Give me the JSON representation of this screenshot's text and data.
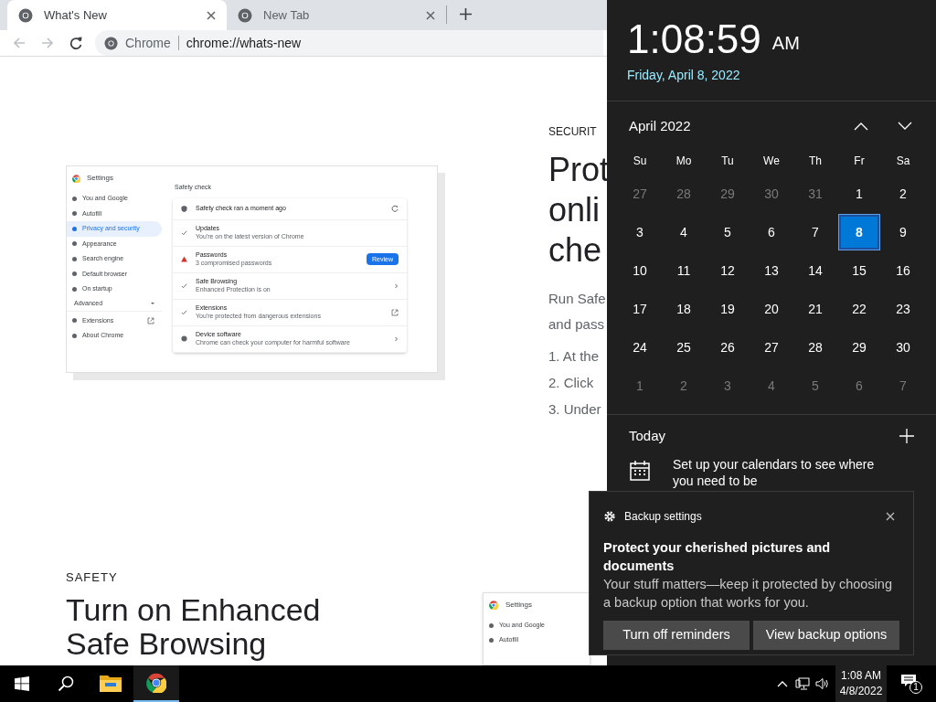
{
  "browser": {
    "tabs": [
      {
        "title": "What's New",
        "selected": true
      },
      {
        "title": "New Tab",
        "selected": false
      }
    ],
    "address": {
      "site": "Chrome",
      "url": "chrome://whats-new"
    }
  },
  "page": {
    "inset": {
      "title": "Settings",
      "nav": [
        {
          "label": "You and Google",
          "selected": false
        },
        {
          "label": "Autofill",
          "selected": false
        },
        {
          "label": "Privacy and security",
          "selected": true
        },
        {
          "label": "Appearance",
          "selected": false
        },
        {
          "label": "Search engine",
          "selected": false
        },
        {
          "label": "Default browser",
          "selected": false
        },
        {
          "label": "On startup",
          "selected": false
        }
      ],
      "advanced": "Advanced",
      "nav_bottom": [
        {
          "label": "Extensions",
          "kind": "external"
        },
        {
          "label": "About Chrome",
          "kind": "plain"
        }
      ],
      "section": "Safety check",
      "rows": [
        {
          "kind": "status",
          "title": "Safety check ran a moment ago",
          "trail": {
            "kind": "refresh"
          }
        },
        {
          "kind": "check",
          "title": "Updates",
          "subtitle": "You're on the latest version of Chrome"
        },
        {
          "kind": "warning",
          "title": "Passwords",
          "subtitle": "3 compromised passwords",
          "trail": {
            "kind": "button",
            "label": "Review"
          }
        },
        {
          "kind": "check",
          "title": "Safe Browsing",
          "subtitle": "Enhanced Protection is on",
          "trail": {
            "kind": "chevron"
          }
        },
        {
          "kind": "check",
          "title": "Extensions",
          "subtitle": "You're protected from dangerous extensions",
          "trail": {
            "kind": "external"
          }
        },
        {
          "kind": "info",
          "title": "Device software",
          "subtitle": "Chrome can check your computer for harmful software",
          "trail": {
            "kind": "chevron"
          }
        }
      ]
    },
    "security": {
      "eyebrow": "SECURIT",
      "heading": [
        "Prot",
        "onli",
        "che"
      ],
      "body": [
        "Run Safe",
        "and pass"
      ],
      "steps": [
        "1. At the",
        "2. Click",
        "3. Under"
      ]
    },
    "safety": {
      "eyebrow": "SAFETY",
      "heading": [
        "Turn on Enhanced",
        "Safe Browsing"
      ]
    },
    "inset2": {
      "title": "Settings",
      "nav": [
        "You and Google",
        "Autofill"
      ]
    }
  },
  "calendar": {
    "time": "1:08:59",
    "ampm": "AM",
    "date": "Friday, April 8, 2022",
    "month": "April 2022",
    "weekdays": [
      "Su",
      "Mo",
      "Tu",
      "We",
      "Th",
      "Fr",
      "Sa"
    ],
    "weeks": [
      [
        {
          "d": "27",
          "in_month": false,
          "selected": false
        },
        {
          "d": "28",
          "in_month": false,
          "selected": false
        },
        {
          "d": "29",
          "in_month": false,
          "selected": false
        },
        {
          "d": "30",
          "in_month": false,
          "selected": false
        },
        {
          "d": "31",
          "in_month": false,
          "selected": false
        },
        {
          "d": "1",
          "in_month": true,
          "selected": false
        },
        {
          "d": "2",
          "in_month": true,
          "selected": false
        }
      ],
      [
        {
          "d": "3",
          "in_month": true,
          "selected": false
        },
        {
          "d": "4",
          "in_month": true,
          "selected": false
        },
        {
          "d": "5",
          "in_month": true,
          "selected": false
        },
        {
          "d": "6",
          "in_month": true,
          "selected": false
        },
        {
          "d": "7",
          "in_month": true,
          "selected": false
        },
        {
          "d": "8",
          "in_month": true,
          "selected": true
        },
        {
          "d": "9",
          "in_month": true,
          "selected": false
        }
      ],
      [
        {
          "d": "10",
          "in_month": true,
          "selected": false
        },
        {
          "d": "11",
          "in_month": true,
          "selected": false
        },
        {
          "d": "12",
          "in_month": true,
          "selected": false
        },
        {
          "d": "13",
          "in_month": true,
          "selected": false
        },
        {
          "d": "14",
          "in_month": true,
          "selected": false
        },
        {
          "d": "15",
          "in_month": true,
          "selected": false
        },
        {
          "d": "16",
          "in_month": true,
          "selected": false
        }
      ],
      [
        {
          "d": "17",
          "in_month": true,
          "selected": false
        },
        {
          "d": "18",
          "in_month": true,
          "selected": false
        },
        {
          "d": "19",
          "in_month": true,
          "selected": false
        },
        {
          "d": "20",
          "in_month": true,
          "selected": false
        },
        {
          "d": "21",
          "in_month": true,
          "selected": false
        },
        {
          "d": "22",
          "in_month": true,
          "selected": false
        },
        {
          "d": "23",
          "in_month": true,
          "selected": false
        }
      ],
      [
        {
          "d": "24",
          "in_month": true,
          "selected": false
        },
        {
          "d": "25",
          "in_month": true,
          "selected": false
        },
        {
          "d": "26",
          "in_month": true,
          "selected": false
        },
        {
          "d": "27",
          "in_month": true,
          "selected": false
        },
        {
          "d": "28",
          "in_month": true,
          "selected": false
        },
        {
          "d": "29",
          "in_month": true,
          "selected": false
        },
        {
          "d": "30",
          "in_month": true,
          "selected": false
        }
      ],
      [
        {
          "d": "1",
          "in_month": false,
          "selected": false
        },
        {
          "d": "2",
          "in_month": false,
          "selected": false
        },
        {
          "d": "3",
          "in_month": false,
          "selected": false
        },
        {
          "d": "4",
          "in_month": false,
          "selected": false
        },
        {
          "d": "5",
          "in_month": false,
          "selected": false
        },
        {
          "d": "6",
          "in_month": false,
          "selected": false
        },
        {
          "d": "7",
          "in_month": false,
          "selected": false
        }
      ]
    ],
    "today": "Today",
    "agenda_hint": "Set up your calendars to see where you need to be"
  },
  "toast": {
    "app": "Backup settings",
    "title": "Protect your cherished pictures and documents",
    "body": "Your stuff matters—keep it protected by choosing a backup option that works for you.",
    "buttons": [
      "Turn off reminders",
      "View backup options"
    ]
  },
  "taskbar": {
    "apps": [
      {
        "kind": "explorer",
        "active": false
      },
      {
        "kind": "chrome",
        "active": true
      }
    ],
    "time": "1:08 AM",
    "date": "4/8/2022",
    "notifications": "1"
  }
}
